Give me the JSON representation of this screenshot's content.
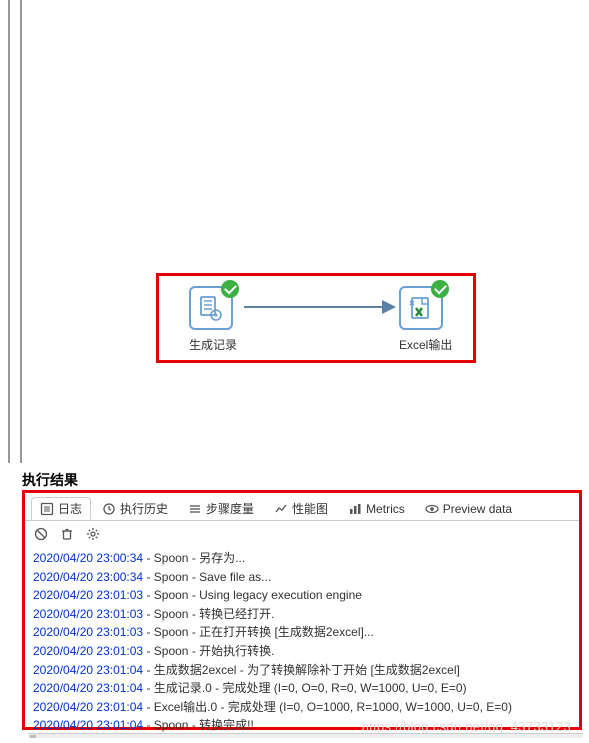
{
  "flow": {
    "node1_label": "生成记录",
    "node2_label": "Excel输出"
  },
  "section_title": "执行结果",
  "tabs": {
    "log": "日志",
    "history": "执行历史",
    "step": "步骤度量",
    "perf": "性能图",
    "metrics": "Metrics",
    "preview": "Preview data"
  },
  "log": [
    {
      "ts": "2020/04/20 23:00:34",
      "msg": "Spoon - 另存为..."
    },
    {
      "ts": "2020/04/20 23:00:34",
      "msg": "Spoon - Save file as..."
    },
    {
      "ts": "2020/04/20 23:01:03",
      "msg": "Spoon - Using legacy execution engine"
    },
    {
      "ts": "2020/04/20 23:01:03",
      "msg": "Spoon - 转换已经打开."
    },
    {
      "ts": "2020/04/20 23:01:03",
      "msg": "Spoon - 正在打开转换 [生成数据2excel]..."
    },
    {
      "ts": "2020/04/20 23:01:03",
      "msg": "Spoon - 开始执行转换."
    },
    {
      "ts": "2020/04/20 23:01:04",
      "msg": "生成数据2excel - 为了转换解除补丁开始  [生成数据2excel]"
    },
    {
      "ts": "2020/04/20 23:01:04",
      "msg": "生成记录.0 - 完成处理 (I=0, O=0, R=0, W=1000, U=0, E=0)"
    },
    {
      "ts": "2020/04/20 23:01:04",
      "msg": "Excel输出.0 - 完成处理 (I=0, O=1000, R=1000, W=1000, U=0, E=0)"
    },
    {
      "ts": "2020/04/20 23:01:04",
      "msg": "Spoon - 转换完成!!"
    }
  ],
  "watermark": "https://blog.csdn.net/qq_43733123"
}
